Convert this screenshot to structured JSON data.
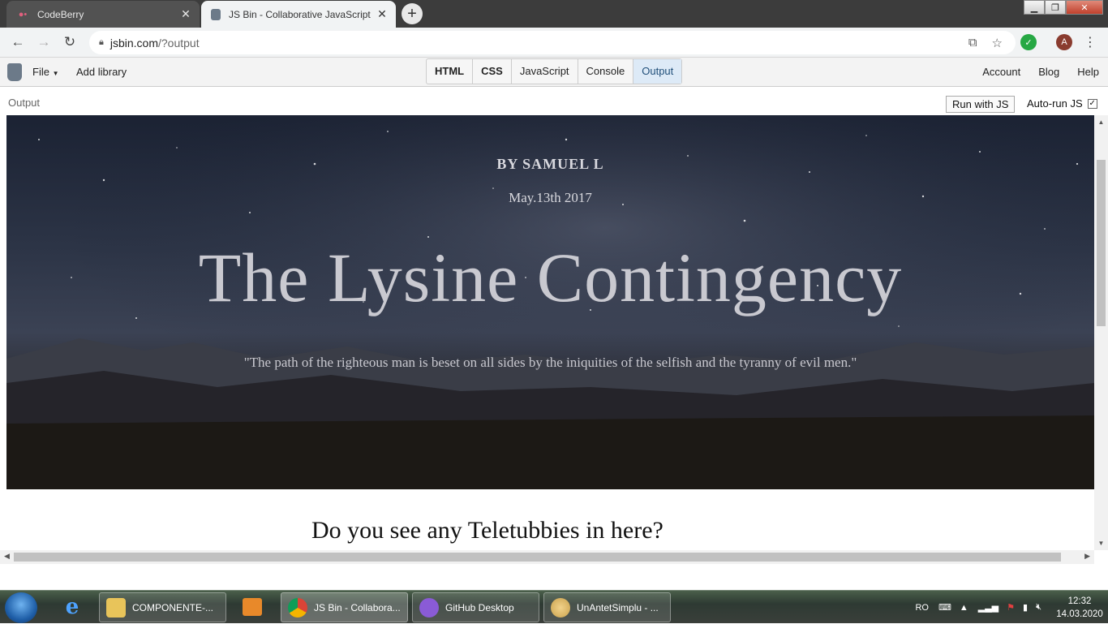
{
  "browser": {
    "tabs": [
      {
        "title": "CodeBerry",
        "active": false
      },
      {
        "title": "JS Bin - Collaborative JavaScript Debugging",
        "active": true
      }
    ],
    "url_host": "jsbin.com",
    "url_path": "/?output",
    "profile_initial": "A",
    "ext_badge": "0"
  },
  "jsbin": {
    "file_label": "File",
    "add_library": "Add library",
    "panels": [
      "HTML",
      "CSS",
      "JavaScript",
      "Console",
      "Output"
    ],
    "right_links": [
      "Account",
      "Blog",
      "Help"
    ],
    "output_label": "Output",
    "run_button": "Run with JS",
    "autorun_label": "Auto-run JS"
  },
  "page": {
    "byline": "BY SAMUEL L",
    "date": "May.13th 2017",
    "headline": "The Lysine Contingency",
    "quote": "\"The path of the righteous man is beset on all sides by the iniquities of the selfish and the tyranny of evil men.\"",
    "subheading": "Do you see any Teletubbies in here?"
  },
  "taskbar": {
    "tasks": [
      "COMPONENTE-...",
      "JS Bin - Collabora...",
      "GitHub Desktop",
      "UnAntetSimplu - ..."
    ],
    "lang": "RO",
    "time": "12:32",
    "date": "14.03.2020"
  },
  "colors": {
    "chrome_dark": "#3c3c3c",
    "output_tab_active": "#ddeaf7",
    "hero_sky": "#2c3446"
  }
}
